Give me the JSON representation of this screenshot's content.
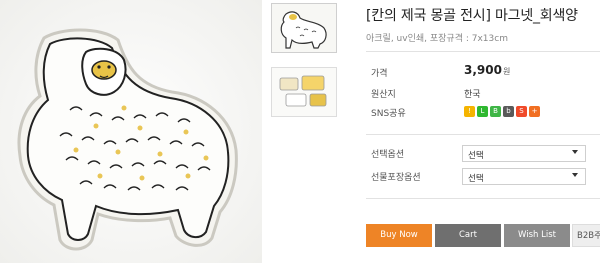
{
  "product": {
    "title": "[칸의 제국 몽골 전시] 마그넷_회색양",
    "subtitle": "아크릴, uv인쇄, 포장규격 : 7x13cm"
  },
  "gallery": {
    "main_image": "acrylic-sheep-magnet",
    "thumbnails": [
      "sheep-magnet-thumb",
      "magnet-set-thumb"
    ]
  },
  "details": {
    "price_label": "가격",
    "price_value": "3,900",
    "price_unit": "원",
    "origin_label": "원산지",
    "origin_value": "한국",
    "sns_label": "SNS공유",
    "sns_icons": [
      {
        "name": "kakaostory-icon",
        "glyph": "!",
        "color": "#f5b400"
      },
      {
        "name": "line-icon",
        "glyph": "L",
        "color": "#2fb830"
      },
      {
        "name": "band-icon",
        "glyph": "B",
        "color": "#3fb546"
      },
      {
        "name": "blog-icon",
        "glyph": "b",
        "color": "#5a5a5a"
      },
      {
        "name": "share-icon",
        "glyph": "S",
        "color": "#f04a2a"
      },
      {
        "name": "plus-icon",
        "glyph": "+",
        "color": "#f16f22"
      }
    ]
  },
  "options": {
    "option1_label": "선택옵션",
    "option1_value": "선택",
    "option2_label": "선물포장옵션",
    "option2_value": "선택"
  },
  "actions": {
    "buy_now": "Buy Now",
    "cart": "Cart",
    "wish_list": "Wish List",
    "b2b": "B2B주"
  }
}
